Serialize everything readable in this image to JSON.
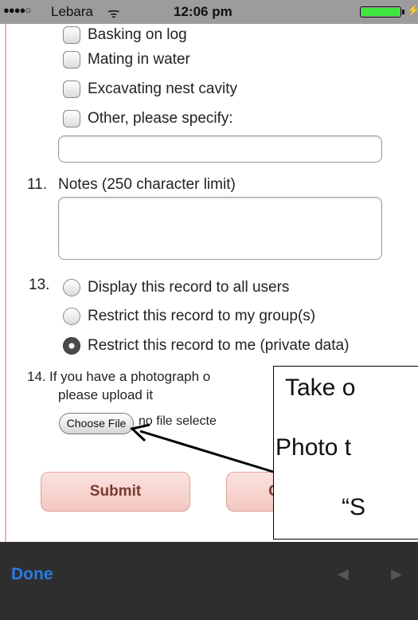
{
  "status_bar": {
    "signal": "●●●●○",
    "carrier": "Lebara",
    "wifi": "ᯤ",
    "time": "12:06 pm",
    "battery_level": 1.0,
    "charge": "⚡"
  },
  "form": {
    "checkboxes": [
      {
        "label": "Basking on log",
        "checked": false
      },
      {
        "label": "Mating in water",
        "checked": false
      },
      {
        "label": "Excavating nest cavity",
        "checked": false
      },
      {
        "label": "Other, please specify:",
        "checked": false
      }
    ],
    "other_value": "",
    "q11": {
      "number": "11.",
      "label": "Notes (250 character limit)",
      "value": ""
    },
    "q13": {
      "number": "13.",
      "options": [
        {
          "label": "Display this record to all users",
          "checked": false
        },
        {
          "label": "Restrict this record to my group(s)",
          "checked": false
        },
        {
          "label": "Restrict this record to me (private data)",
          "checked": true
        }
      ]
    },
    "q14": {
      "number": "14.",
      "line1": "If you have a photograph o",
      "line2": "please upload it",
      "choose_file_label": "Choose File",
      "no_file_text": "no file selecte"
    },
    "submit_label": "Submit",
    "second_button_label": "C"
  },
  "callout": {
    "line1": "Take o",
    "line2": "Photo t",
    "line3": "“S"
  },
  "toolbar": {
    "done_label": "Done",
    "prev_icon": "◀",
    "next_icon": "▶"
  },
  "colors": {
    "status_bar_bg": "#9c9c9c",
    "button_bg": "#f3c8c1",
    "button_text": "#7a3a30",
    "toolbar_bg": "#2e2e2e",
    "done_text": "#2a7be4"
  }
}
